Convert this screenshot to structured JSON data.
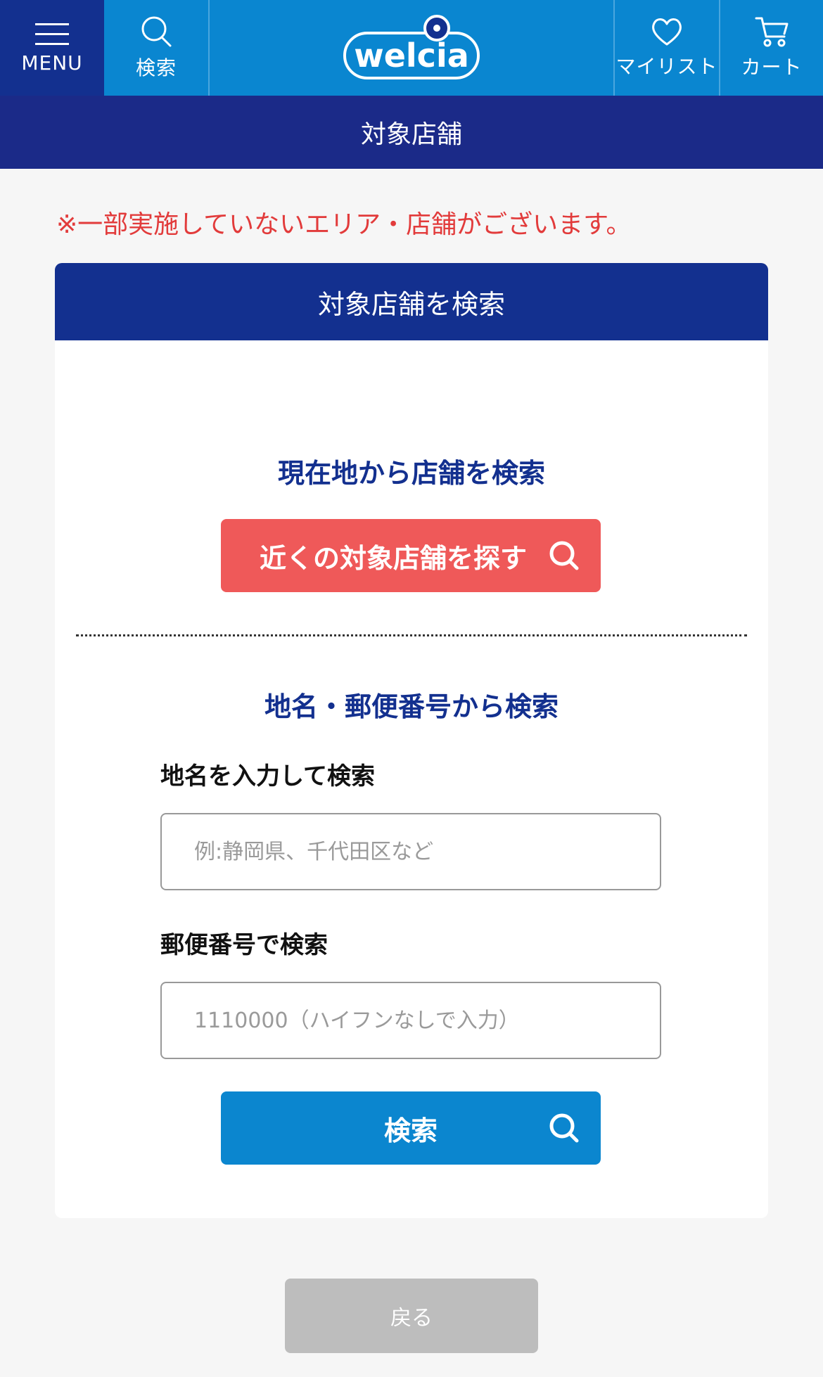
{
  "header": {
    "menu_label": "MENU",
    "search_label": "検索",
    "logo_text": "welcia",
    "mylist_label": "マイリスト",
    "cart_label": "カート"
  },
  "subheader": {
    "title": "対象店舗"
  },
  "notice": "※一部実施していないエリア・店舗がございます。",
  "card": {
    "title": "対象店舗を検索",
    "current_location": {
      "heading": "現在地から店舗を検索",
      "button_label": "近くの対象店舗を探す"
    },
    "place_search": {
      "heading": "地名・郵便番号から検索",
      "place_label": "地名を入力して検索",
      "place_placeholder": "例:静岡県、千代田区など",
      "zip_label": "郵便番号で検索",
      "zip_placeholder": "1110000（ハイフンなしで入力）",
      "search_button_label": "検索"
    }
  },
  "back_button_label": "戻る",
  "colors": {
    "header_blue": "#0a86d0",
    "navy": "#13308f",
    "notice_red": "#e23b3b",
    "red_button": "#ef5959",
    "blue_button": "#0b86cf"
  }
}
